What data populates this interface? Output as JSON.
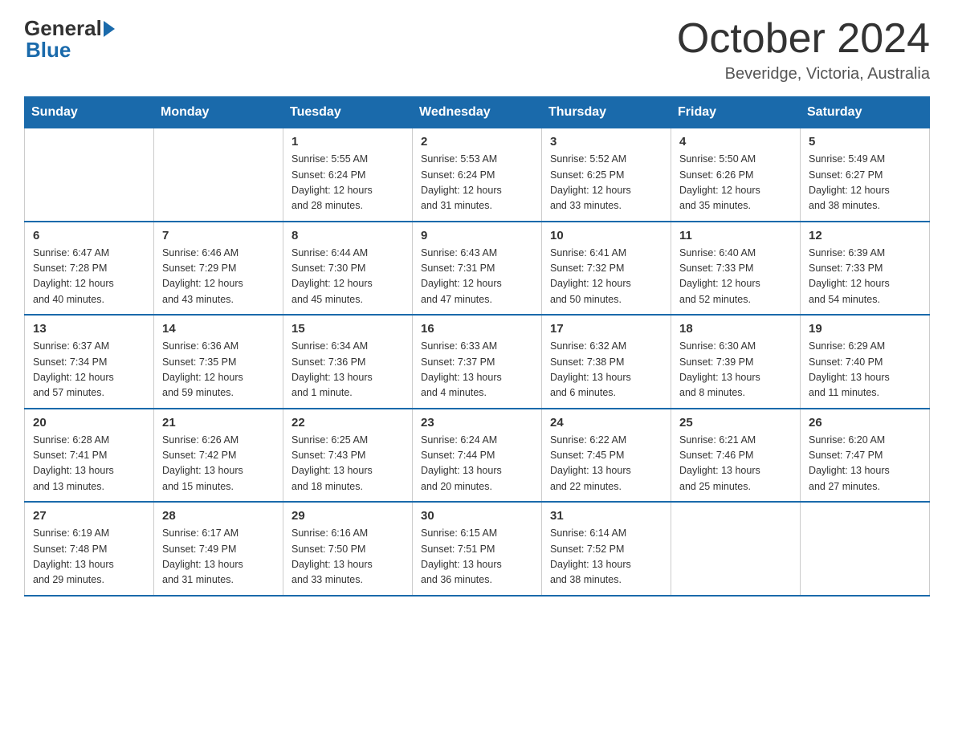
{
  "header": {
    "logo_general": "General",
    "logo_blue": "Blue",
    "month_title": "October 2024",
    "location": "Beveridge, Victoria, Australia"
  },
  "calendar": {
    "days_of_week": [
      "Sunday",
      "Monday",
      "Tuesday",
      "Wednesday",
      "Thursday",
      "Friday",
      "Saturday"
    ],
    "weeks": [
      [
        {
          "day": "",
          "info": ""
        },
        {
          "day": "",
          "info": ""
        },
        {
          "day": "1",
          "info": "Sunrise: 5:55 AM\nSunset: 6:24 PM\nDaylight: 12 hours\nand 28 minutes."
        },
        {
          "day": "2",
          "info": "Sunrise: 5:53 AM\nSunset: 6:24 PM\nDaylight: 12 hours\nand 31 minutes."
        },
        {
          "day": "3",
          "info": "Sunrise: 5:52 AM\nSunset: 6:25 PM\nDaylight: 12 hours\nand 33 minutes."
        },
        {
          "day": "4",
          "info": "Sunrise: 5:50 AM\nSunset: 6:26 PM\nDaylight: 12 hours\nand 35 minutes."
        },
        {
          "day": "5",
          "info": "Sunrise: 5:49 AM\nSunset: 6:27 PM\nDaylight: 12 hours\nand 38 minutes."
        }
      ],
      [
        {
          "day": "6",
          "info": "Sunrise: 6:47 AM\nSunset: 7:28 PM\nDaylight: 12 hours\nand 40 minutes."
        },
        {
          "day": "7",
          "info": "Sunrise: 6:46 AM\nSunset: 7:29 PM\nDaylight: 12 hours\nand 43 minutes."
        },
        {
          "day": "8",
          "info": "Sunrise: 6:44 AM\nSunset: 7:30 PM\nDaylight: 12 hours\nand 45 minutes."
        },
        {
          "day": "9",
          "info": "Sunrise: 6:43 AM\nSunset: 7:31 PM\nDaylight: 12 hours\nand 47 minutes."
        },
        {
          "day": "10",
          "info": "Sunrise: 6:41 AM\nSunset: 7:32 PM\nDaylight: 12 hours\nand 50 minutes."
        },
        {
          "day": "11",
          "info": "Sunrise: 6:40 AM\nSunset: 7:33 PM\nDaylight: 12 hours\nand 52 minutes."
        },
        {
          "day": "12",
          "info": "Sunrise: 6:39 AM\nSunset: 7:33 PM\nDaylight: 12 hours\nand 54 minutes."
        }
      ],
      [
        {
          "day": "13",
          "info": "Sunrise: 6:37 AM\nSunset: 7:34 PM\nDaylight: 12 hours\nand 57 minutes."
        },
        {
          "day": "14",
          "info": "Sunrise: 6:36 AM\nSunset: 7:35 PM\nDaylight: 12 hours\nand 59 minutes."
        },
        {
          "day": "15",
          "info": "Sunrise: 6:34 AM\nSunset: 7:36 PM\nDaylight: 13 hours\nand 1 minute."
        },
        {
          "day": "16",
          "info": "Sunrise: 6:33 AM\nSunset: 7:37 PM\nDaylight: 13 hours\nand 4 minutes."
        },
        {
          "day": "17",
          "info": "Sunrise: 6:32 AM\nSunset: 7:38 PM\nDaylight: 13 hours\nand 6 minutes."
        },
        {
          "day": "18",
          "info": "Sunrise: 6:30 AM\nSunset: 7:39 PM\nDaylight: 13 hours\nand 8 minutes."
        },
        {
          "day": "19",
          "info": "Sunrise: 6:29 AM\nSunset: 7:40 PM\nDaylight: 13 hours\nand 11 minutes."
        }
      ],
      [
        {
          "day": "20",
          "info": "Sunrise: 6:28 AM\nSunset: 7:41 PM\nDaylight: 13 hours\nand 13 minutes."
        },
        {
          "day": "21",
          "info": "Sunrise: 6:26 AM\nSunset: 7:42 PM\nDaylight: 13 hours\nand 15 minutes."
        },
        {
          "day": "22",
          "info": "Sunrise: 6:25 AM\nSunset: 7:43 PM\nDaylight: 13 hours\nand 18 minutes."
        },
        {
          "day": "23",
          "info": "Sunrise: 6:24 AM\nSunset: 7:44 PM\nDaylight: 13 hours\nand 20 minutes."
        },
        {
          "day": "24",
          "info": "Sunrise: 6:22 AM\nSunset: 7:45 PM\nDaylight: 13 hours\nand 22 minutes."
        },
        {
          "day": "25",
          "info": "Sunrise: 6:21 AM\nSunset: 7:46 PM\nDaylight: 13 hours\nand 25 minutes."
        },
        {
          "day": "26",
          "info": "Sunrise: 6:20 AM\nSunset: 7:47 PM\nDaylight: 13 hours\nand 27 minutes."
        }
      ],
      [
        {
          "day": "27",
          "info": "Sunrise: 6:19 AM\nSunset: 7:48 PM\nDaylight: 13 hours\nand 29 minutes."
        },
        {
          "day": "28",
          "info": "Sunrise: 6:17 AM\nSunset: 7:49 PM\nDaylight: 13 hours\nand 31 minutes."
        },
        {
          "day": "29",
          "info": "Sunrise: 6:16 AM\nSunset: 7:50 PM\nDaylight: 13 hours\nand 33 minutes."
        },
        {
          "day": "30",
          "info": "Sunrise: 6:15 AM\nSunset: 7:51 PM\nDaylight: 13 hours\nand 36 minutes."
        },
        {
          "day": "31",
          "info": "Sunrise: 6:14 AM\nSunset: 7:52 PM\nDaylight: 13 hours\nand 38 minutes."
        },
        {
          "day": "",
          "info": ""
        },
        {
          "day": "",
          "info": ""
        }
      ]
    ]
  }
}
